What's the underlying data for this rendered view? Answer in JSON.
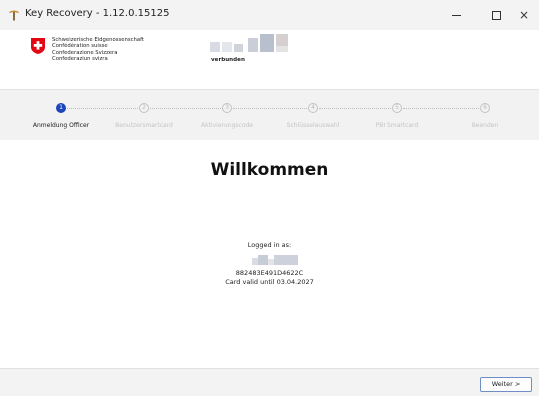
{
  "window": {
    "title": "Key Recovery - 1.12.0.15125",
    "app_icon": "pickaxe-key-icon",
    "controls": {
      "minimize": "minimize-icon",
      "maximize": "maximize-icon",
      "close": "×"
    }
  },
  "header": {
    "org_names": [
      "Schweizerische Eidgenossenschaft",
      "Confédération suisse",
      "Confederazione Svizzera",
      "Confederaziun svizra"
    ],
    "crest": "swiss-crest-icon",
    "connection_status": "verbunden"
  },
  "wizard": {
    "steps": [
      {
        "number": "1",
        "label": "Anmeldung Officer",
        "active": true
      },
      {
        "number": "2",
        "label": "Benutzersmartcard",
        "active": false
      },
      {
        "number": "3",
        "label": "Aktivierungscode",
        "active": false
      },
      {
        "number": "4",
        "label": "Schlüsselauswahl",
        "active": false
      },
      {
        "number": "5",
        "label": "PBI Smartcard",
        "active": false
      },
      {
        "number": "6",
        "label": "Beenden",
        "active": false
      }
    ]
  },
  "main": {
    "heading": "Willkommen",
    "logged_in_label": "Logged in as:",
    "card_id": "882483E491D4622C",
    "card_valid": "Card valid until 03.04.2027"
  },
  "footer": {
    "next_label": "Weiter >"
  },
  "colors": {
    "accent": "#1a46b8",
    "swiss_red": "#e30613",
    "stepper_bg": "#f2f2f2"
  }
}
